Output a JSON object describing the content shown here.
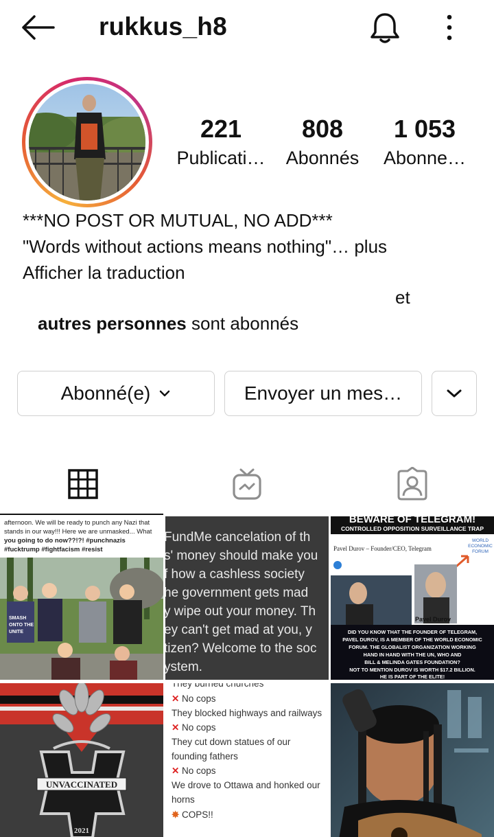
{
  "header": {
    "username": "rukkus_h8"
  },
  "stats": [
    {
      "value": "221",
      "label": "Publicati…"
    },
    {
      "value": "808",
      "label": "Abonnés"
    },
    {
      "value": "1 053",
      "label": "Abonne…"
    }
  ],
  "bio": {
    "line1": "***NO POST OR MUTUAL, NO ADD***",
    "line2": "\"Words without actions means nothing\"…",
    "more": "plus",
    "translate": "Afficher la traduction"
  },
  "followed_by": {
    "et": "et",
    "bold": "autres personnes",
    "rest": "sont abonnés"
  },
  "buttons": {
    "follow": "Abonné(e)",
    "message": "Envoyer un mes…"
  },
  "posts": [
    {
      "lines": [
        "afternoon. We will be ready to punch any Nazi that",
        "stands in our way!!! Here we are unmasked... What",
        "you going to do now??!?! #punchnazis",
        "#fucktrump #fightfacism #resist"
      ],
      "shirt": [
        "SMASH",
        "ONTO THE",
        "UNITE"
      ]
    },
    {
      "lines": [
        "FundMe cancelation of th",
        "s' money should make you",
        "f how a cashless society",
        "he government gets mad",
        "y wipe out your money. Th",
        "ey can't get mad at you, y",
        "tizen? Welcome to the soc",
        "ystem."
      ]
    },
    {
      "top": "BEWARE OF TELEGRAM!",
      "sub": "CONTROLLED OPPOSITION SURVEILLANCE TRAP",
      "article": "Pavel Durov – Founder/CEO, Telegram",
      "wef": [
        "WORLD",
        "ECONOMIC",
        "FORUM"
      ],
      "caption": "Pavel Durov",
      "bottom": [
        "DID YOU KNOW THAT THE FOUNDER OF TELEGRAM,",
        "PAVEL DUROV, IS A MEMBER OF THE WORLD ECONOMIC",
        "FORUM. THE GLOBALIST ORGANIZATION WORKING",
        "HAND IN HAND WITH THE UN, WHO AND",
        "BILL & MELINDA GATES FOUNDATION?",
        "NOT TO MENTION DUROV IS WORTH $17.2 BILLION.",
        "HE IS PART OF THE ELITE!"
      ]
    },
    {
      "banner": "UNVACCINATED",
      "year": "2021"
    },
    {
      "lines": [
        "They burned churches",
        "No cops",
        "They blocked highways and railways",
        "No cops",
        "They cut down statues of our",
        "founding fathers",
        "No cops",
        "We drove to Ottawa and honked our",
        "horns",
        "COPS!!"
      ]
    },
    {}
  ],
  "colors": {
    "accent": "#c13584",
    "border": "#d0d0d0"
  }
}
